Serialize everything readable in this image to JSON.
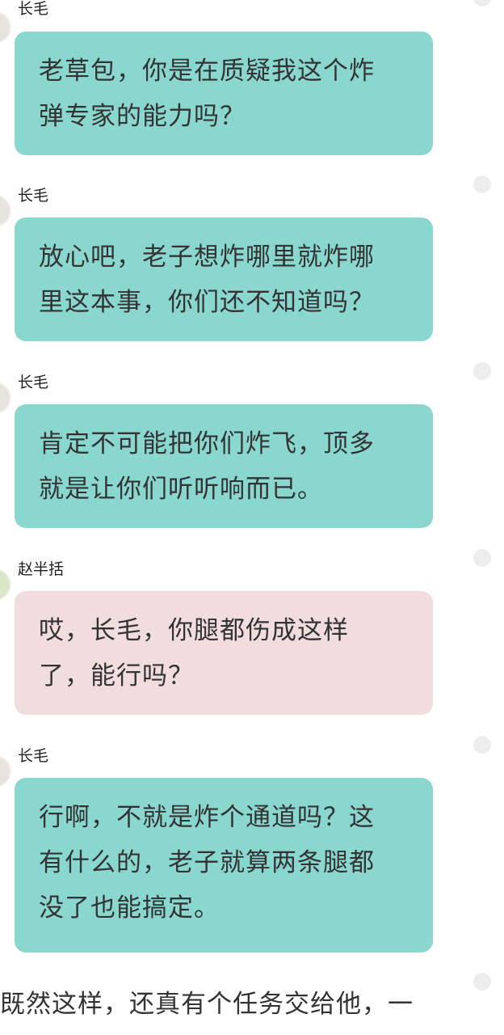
{
  "messages": [
    {
      "sender": "长毛",
      "bubble_style": "teal",
      "lines": [
        "老草包，你是在质疑我这个炸",
        "弹专家的能力吗？"
      ]
    },
    {
      "sender": "长毛",
      "bubble_style": "teal",
      "lines": [
        "放心吧，老子想炸哪里就炸哪",
        "里这本事，你们还不知道吗？"
      ]
    },
    {
      "sender": "长毛",
      "bubble_style": "teal",
      "lines": [
        "肯定不可能把你们炸飞，顶多",
        "就是让你们听听响而已。"
      ]
    },
    {
      "sender": "赵半括",
      "bubble_style": "pink",
      "lines": [
        "哎，长毛，你腿都伤成这样",
        "了，能行吗？"
      ]
    },
    {
      "sender": "长毛",
      "bubble_style": "teal",
      "lines": [
        "行啊，不就是炸个通道吗？这",
        "有什么的，老子就算两条腿都",
        "没了也能搞定。"
      ]
    }
  ],
  "narration": "既然这样，还真有个任务交给他，一",
  "colors": {
    "teal_bubble": "#8ad7cf",
    "pink_bubble": "#f1dddd",
    "text": "#333333",
    "dot": "#ededed"
  }
}
